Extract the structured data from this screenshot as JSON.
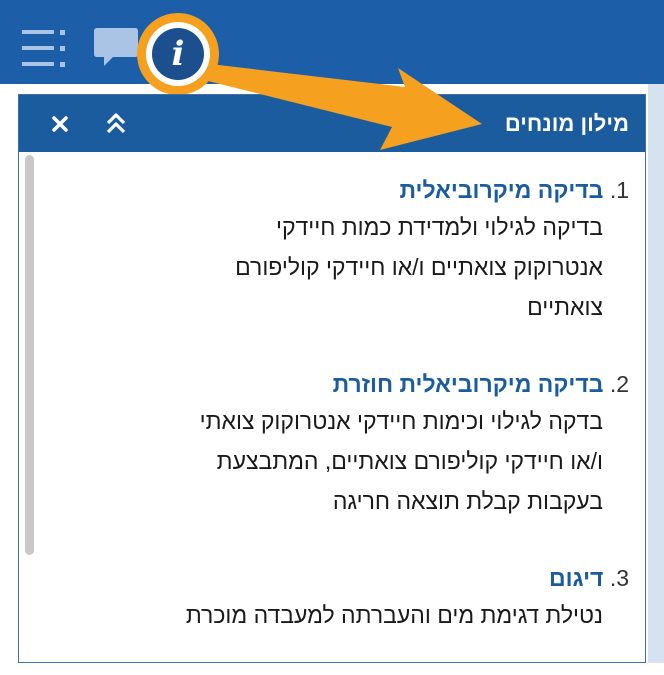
{
  "topbar": {
    "menu_icon": "list-menu-icon",
    "chat_icon": "chat-bubble-icon",
    "info_icon": "info-icon",
    "info_glyph": "i",
    "highlight_color": "#f5a01f",
    "bar_color": "#1c5ea8"
  },
  "panel": {
    "title": "מילון מונחים",
    "close_glyph": "×",
    "collapse_icon": "double-chevron-up-icon",
    "header_color": "#1a5c9e"
  },
  "terms": [
    {
      "num": "1.",
      "title": "בדיקה מיקרוביאלית",
      "definition": [
        "בדיקה לגילוי ולמדידת כמות חיידקי",
        "אנטרוקוק צואתיים ו/או חיידקי קוליפורם",
        "צואתיים"
      ]
    },
    {
      "num": "2.",
      "title": "בדיקה מיקרוביאלית חוזרת",
      "definition": [
        "בדקה לגילוי וכימות חיידקי אנטרוקוק צואתי",
        "ו/או חיידקי קוליפורם צואתיים, המתבצעת",
        "בעקבות קבלת תוצאה חריגה"
      ]
    },
    {
      "num": "3.",
      "title": "דיגום",
      "definition": [
        "נטילת דגימת מים והעברתה למעבדה מוכרת"
      ]
    }
  ]
}
